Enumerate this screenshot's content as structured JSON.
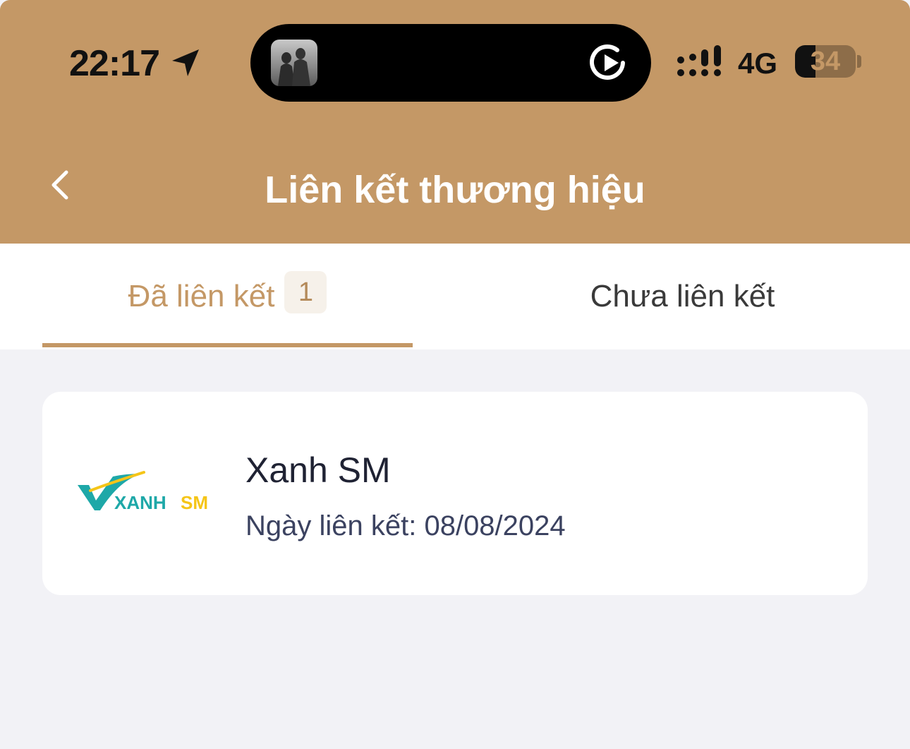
{
  "status_bar": {
    "time": "22:17",
    "network": "4G",
    "battery": "34",
    "battery_level": 0.34,
    "icons": [
      "location-arrow-icon",
      "now-playing-thumbnail",
      "play-icon",
      "signal-icon",
      "battery-icon"
    ]
  },
  "header": {
    "title": "Liên kết thương hiệu",
    "back_icon": "chevron-left-icon",
    "background_color": "#c49866"
  },
  "tabs": [
    {
      "label": "Đã liên kết",
      "badge": "1",
      "active": true
    },
    {
      "label": "Chưa liên kết",
      "active": false
    }
  ],
  "linked_brands": [
    {
      "name": "Xanh SM",
      "linked_date_text": "Ngày liên kết: 08/08/2024",
      "logo": {
        "text_main": "XANH",
        "text_suffix": "SM",
        "main_color": "#1ea8a8",
        "accent_color": "#f5c518"
      }
    }
  ],
  "colors": {
    "accent": "#c49866",
    "page_background": "#f2f2f6",
    "card_background": "#ffffff"
  }
}
